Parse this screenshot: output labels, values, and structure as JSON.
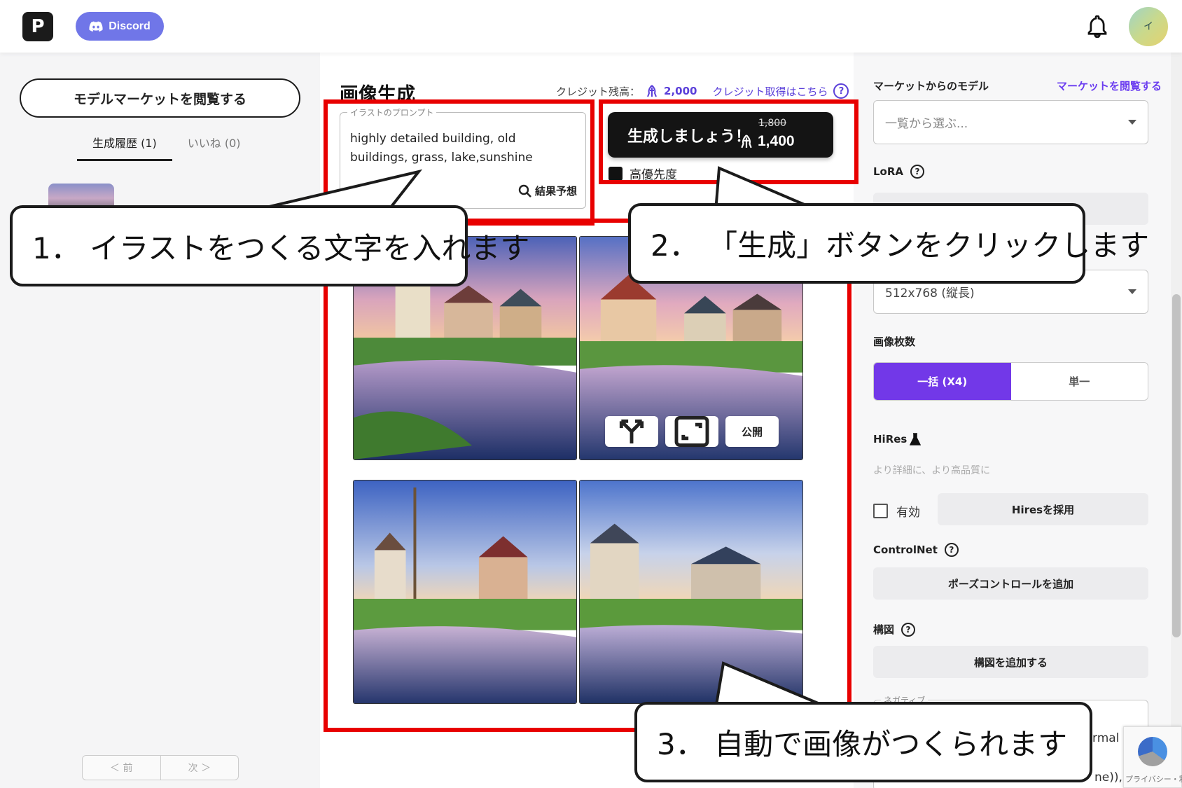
{
  "header": {
    "logo": "P",
    "discord_label": "Discord",
    "avatar_initial": "イ",
    "icons": {
      "bell": "bell-icon",
      "discord": "discord-icon"
    }
  },
  "sidebar": {
    "market_button": "モデルマーケットを閲覧する",
    "tabs": [
      {
        "label": "生成履歴 (1)",
        "active": true
      },
      {
        "label": "いいね (0)",
        "active": false
      }
    ],
    "pager": {
      "prev": "＜ 前",
      "next": "次 ＞"
    }
  },
  "main": {
    "title": "画像生成",
    "credit_label": "クレジット残高：",
    "credit_value": "2,000",
    "credit_link": "クレジット取得はこちら",
    "prompt_legend": "イラストのプロンプト",
    "prompt_text": "highly detailed building, old buildings, grass, lake,sunshine",
    "predict_label": "結果予想",
    "generate_label": "生成しましょう！",
    "generate_old_cost": "1,800",
    "generate_cost": "1,400",
    "priority_label": "高優先度",
    "image_actions": [
      "公開"
    ]
  },
  "settings": {
    "model_label": "マーケットからのモデル",
    "model_link": "マーケットを閲覧する",
    "model_placeholder": "一覧から選ぶ...",
    "lora_label": "LoRA",
    "size_value": "512x768 (縦長)",
    "count_label": "画像枚数",
    "count_options": [
      "一括 (X4)",
      "単一"
    ],
    "hires_label": "HiRes",
    "hires_hint": "より詳細に、より高品質に",
    "hires_enable": "有効",
    "hires_apply": "Hiresを採用",
    "controlnet_label": "ControlNet",
    "controlnet_button": "ポーズコントロールを追加",
    "composition_label": "構図",
    "composition_button": "構図を追加する",
    "negative_legend": "ネガティブ",
    "negative_fragment_1": "rmal",
    "negative_fragment_2": "ne)),"
  },
  "recaptcha": {
    "text": "プライバシー・利用規約"
  },
  "annotations": {
    "step1": "1． イラストをつくる文字を入れます",
    "step2": "2． 「生成」ボタンをクリックします",
    "step3": "3． 自動で画像がつくられます"
  },
  "colors": {
    "accent": "#7238e8",
    "annotation_red": "#e80000",
    "discord": "#7076e8"
  }
}
